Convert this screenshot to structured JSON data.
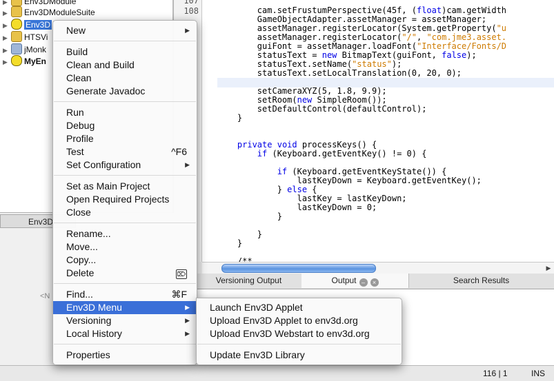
{
  "projects": {
    "items": [
      {
        "label": "Env3DModule",
        "icon": "cup",
        "bold": false,
        "selected": false
      },
      {
        "label": "Env3DModuleSuite",
        "icon": "cup",
        "bold": false,
        "selected": false
      },
      {
        "label": "Env3D",
        "icon": "face",
        "bold": false,
        "selected": true
      },
      {
        "label": "HTSVi",
        "icon": "cup",
        "bold": false,
        "selected": false
      },
      {
        "label": "jMonk",
        "icon": "cube",
        "bold": false,
        "selected": false
      },
      {
        "label": "MyEn",
        "icon": "face",
        "bold": true,
        "selected": false
      }
    ]
  },
  "navigator": {
    "tab_label": "Env3D",
    "empty_label": "<N"
  },
  "editor": {
    "line_numbers": [
      "107",
      "108"
    ],
    "lines": [
      "        cam.setFrustumPerspective(45f, (float)cam.getWidth",
      "        GameObjectAdapter.assetManager = assetManager;",
      "        assetManager.registerLocator(System.getProperty(\"u",
      "        assetManager.registerLocator(\"/\", \"com.jme3.asset.",
      "        guiFont = assetManager.loadFont(\"Interface/Fonts/D",
      "        statusText = new BitmapText(guiFont, false);",
      "        statusText.setName(\"status\");",
      "        statusText.setLocalTranslation(0, 20, 0);",
      "",
      "        setCameraXYZ(5, 1.8, 9.9);",
      "        setRoom(new SimpleRoom());",
      "        setDefaultControl(defaultControl);",
      "    }",
      "",
      "",
      "    private void processKeys() {",
      "        if (Keyboard.getEventKey() != 0) {",
      "",
      "            if (Keyboard.getEventKeyState()) {",
      "                lastKeyDown = Keyboard.getEventKey();",
      "            } else {",
      "                lastKey = lastKeyDown;",
      "                lastKeyDown = 0;",
      "            }",
      "",
      "        }",
      "    }",
      "",
      "    /**"
    ]
  },
  "output_tabs": [
    {
      "label": "Versioning Output",
      "active": false
    },
    {
      "label": "Output",
      "active": true
    },
    {
      "label": "Search Results",
      "active": false
    }
  ],
  "statusbar": {
    "position": "116 | 1",
    "mode": "INS"
  },
  "context_menu": {
    "groups": [
      [
        {
          "label": "New",
          "shortcut": "",
          "submenu": true
        }
      ],
      [
        {
          "label": "Build",
          "shortcut": "",
          "submenu": false
        },
        {
          "label": "Clean and Build",
          "shortcut": "",
          "submenu": false
        },
        {
          "label": "Clean",
          "shortcut": "",
          "submenu": false
        },
        {
          "label": "Generate Javadoc",
          "shortcut": "",
          "submenu": false
        }
      ],
      [
        {
          "label": "Run",
          "shortcut": "",
          "submenu": false
        },
        {
          "label": "Debug",
          "shortcut": "",
          "submenu": false
        },
        {
          "label": "Profile",
          "shortcut": "",
          "submenu": false
        },
        {
          "label": "Test",
          "shortcut": "^F6",
          "submenu": false
        },
        {
          "label": "Set Configuration",
          "shortcut": "",
          "submenu": true
        }
      ],
      [
        {
          "label": "Set as Main Project",
          "shortcut": "",
          "submenu": false
        },
        {
          "label": "Open Required Projects",
          "shortcut": "",
          "submenu": false
        },
        {
          "label": "Close",
          "shortcut": "",
          "submenu": false
        }
      ],
      [
        {
          "label": "Rename...",
          "shortcut": "",
          "submenu": false
        },
        {
          "label": "Move...",
          "shortcut": "",
          "submenu": false
        },
        {
          "label": "Copy...",
          "shortcut": "",
          "submenu": false
        },
        {
          "label": "Delete",
          "shortcut": "⌦",
          "submenu": false
        }
      ],
      [
        {
          "label": "Find...",
          "shortcut": "⌘F",
          "submenu": false
        },
        {
          "label": "Env3D Menu",
          "shortcut": "",
          "submenu": true,
          "highlighted": true
        },
        {
          "label": "Versioning",
          "shortcut": "",
          "submenu": true
        },
        {
          "label": "Local History",
          "shortcut": "",
          "submenu": true
        }
      ],
      [
        {
          "label": "Properties",
          "shortcut": "",
          "submenu": false
        }
      ]
    ]
  },
  "submenu": {
    "groups": [
      [
        {
          "label": "Launch Env3D Applet"
        },
        {
          "label": "Upload Env3D Applet to env3d.org"
        },
        {
          "label": "Upload Env3D Webstart to env3d.org"
        }
      ],
      [
        {
          "label": "Update Env3D Library"
        }
      ]
    ]
  },
  "colors": {
    "highlight": "#3a6fd8",
    "keyword": "#0000e6",
    "string": "#ce7b00"
  }
}
